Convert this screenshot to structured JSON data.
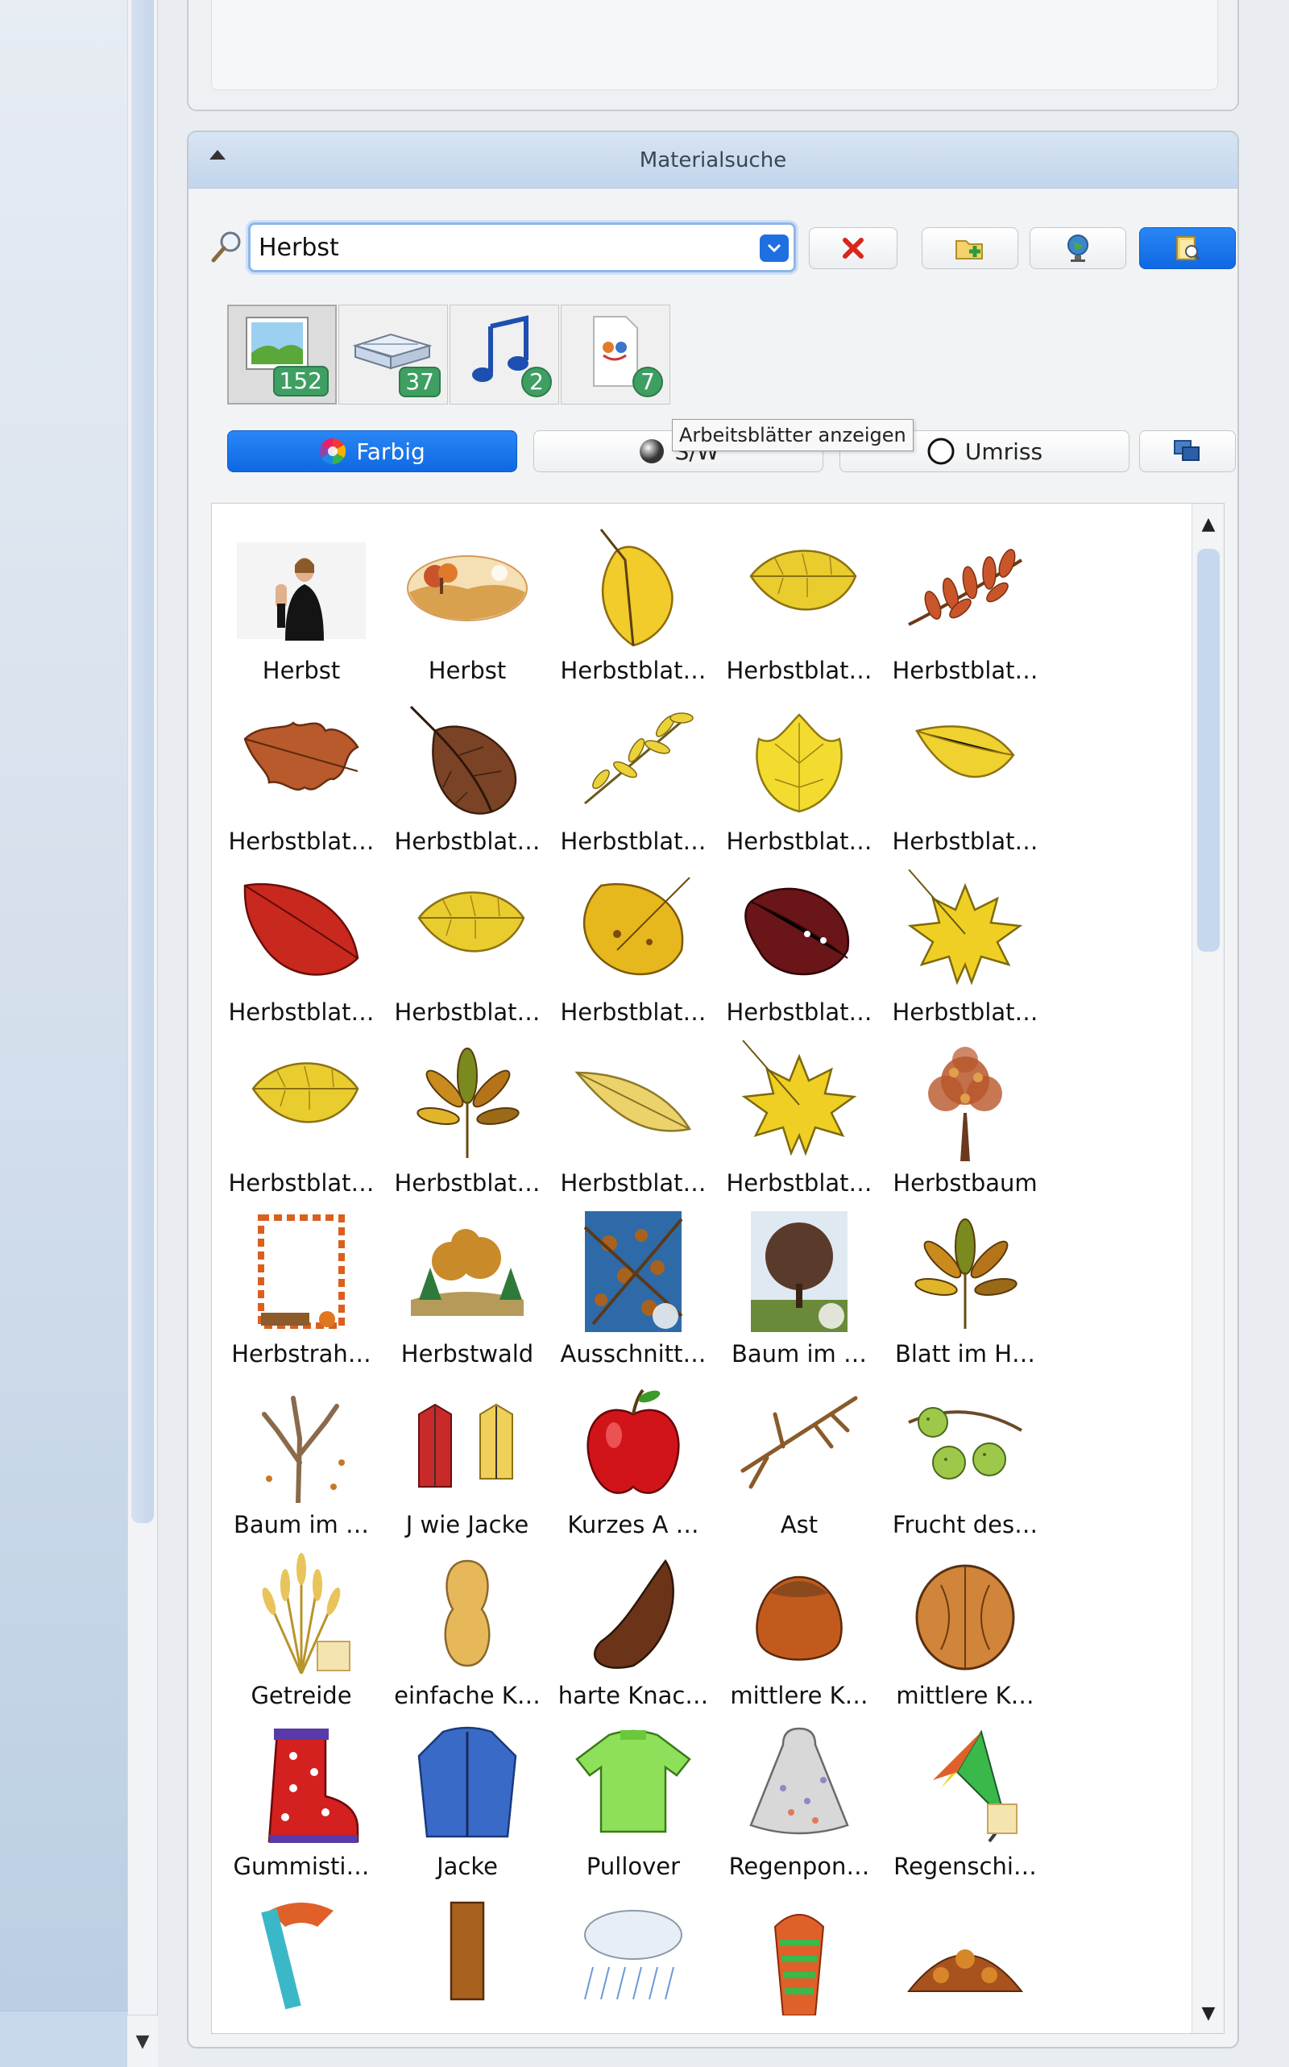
{
  "panel": {
    "title": "Materialsuche"
  },
  "search": {
    "value": "Herbst"
  },
  "categories": [
    {
      "name": "images",
      "count": "152"
    },
    {
      "name": "books",
      "count": "37"
    },
    {
      "name": "music",
      "count": "2"
    },
    {
      "name": "worksheets",
      "count": "7"
    }
  ],
  "filters": {
    "color": "Farbig",
    "bw": "S/W",
    "outline": "Umriss"
  },
  "tooltip": "Arbeitsblätter anzeigen",
  "colors": {
    "accent": "#1a73e8",
    "badge": "#3f9f63",
    "header": "#c8daf0"
  },
  "grid": {
    "items": [
      {
        "label": "Herbst",
        "icon": "sign-language-photo"
      },
      {
        "label": "Herbst",
        "icon": "autumn-landscape"
      },
      {
        "label": "Herbstblat…",
        "icon": "birch-leaf"
      },
      {
        "label": "Herbstblat…",
        "icon": "yellow-leaf"
      },
      {
        "label": "Herbstblat…",
        "icon": "rowan-twig"
      },
      {
        "label": "Herbstblat…",
        "icon": "oak-leaf"
      },
      {
        "label": "Herbstblat…",
        "icon": "brown-leaf"
      },
      {
        "label": "Herbstblat…",
        "icon": "ash-twig"
      },
      {
        "label": "Herbstblat…",
        "icon": "linden-leaf"
      },
      {
        "label": "Herbstblat…",
        "icon": "small-yellow-leaf"
      },
      {
        "label": "Herbstblat…",
        "icon": "red-leaf"
      },
      {
        "label": "Herbstblat…",
        "icon": "yellow-leaf"
      },
      {
        "label": "Herbstblat…",
        "icon": "spotted-leaf"
      },
      {
        "label": "Herbstblat…",
        "icon": "dark-red-leaf"
      },
      {
        "label": "Herbstblat…",
        "icon": "maple-leaf"
      },
      {
        "label": "Herbstblat…",
        "icon": "yellow-leaf"
      },
      {
        "label": "Herbstblat…",
        "icon": "chestnut-leaf"
      },
      {
        "label": "Herbstblat…",
        "icon": "narrow-leaf"
      },
      {
        "label": "Herbstblat…",
        "icon": "maple-leaf"
      },
      {
        "label": "Herbstbaum",
        "icon": "autumn-tree"
      },
      {
        "label": "Herbstrah…",
        "icon": "autumn-frame"
      },
      {
        "label": "Herbstwald",
        "icon": "autumn-forest"
      },
      {
        "label": "Ausschnitt…",
        "icon": "photo-berries"
      },
      {
        "label": "Baum im …",
        "icon": "photo-tree"
      },
      {
        "label": "Blatt im H…",
        "icon": "chestnut-leaf"
      },
      {
        "label": "Baum im …",
        "icon": "bare-tree"
      },
      {
        "label": "J wie Jacke",
        "icon": "jackets"
      },
      {
        "label": "Kurzes A …",
        "icon": "apple"
      },
      {
        "label": "Ast",
        "icon": "branch"
      },
      {
        "label": "Frucht des…",
        "icon": "chestnut-fruit"
      },
      {
        "label": "Getreide",
        "icon": "wheat"
      },
      {
        "label": "einfache K…",
        "icon": "peanut"
      },
      {
        "label": "harte Knac…",
        "icon": "brazil-nut"
      },
      {
        "label": "mittlere K…",
        "icon": "hazelnut"
      },
      {
        "label": "mittlere K…",
        "icon": "walnut"
      },
      {
        "label": "Gummisti…",
        "icon": "rubber-boot"
      },
      {
        "label": "Jacke",
        "icon": "blue-jacket"
      },
      {
        "label": "Pullover",
        "icon": "green-sweater"
      },
      {
        "label": "Regenpon…",
        "icon": "rain-poncho"
      },
      {
        "label": "Regenschi…",
        "icon": "umbrella"
      },
      {
        "label": "",
        "icon": "scarf"
      },
      {
        "label": "",
        "icon": "boot"
      },
      {
        "label": "",
        "icon": "rain-cloud"
      },
      {
        "label": "",
        "icon": "striped-scarf"
      },
      {
        "label": "",
        "icon": "leaf-pile"
      }
    ]
  }
}
